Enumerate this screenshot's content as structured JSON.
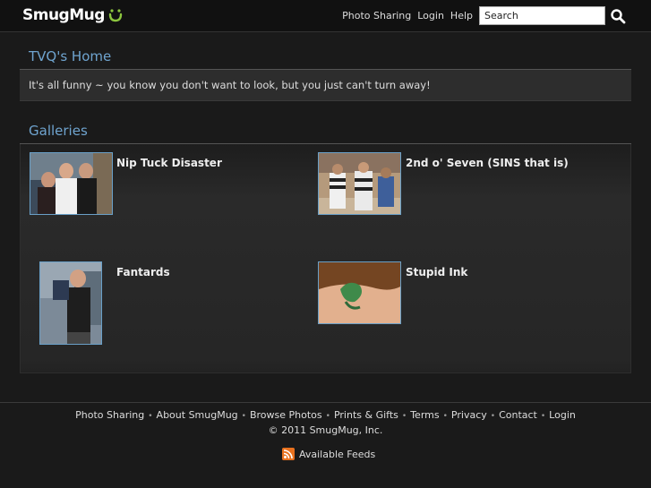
{
  "header": {
    "logo_text": "SmugMug",
    "nav": [
      "Photo Sharing",
      "Login",
      "Help"
    ],
    "search_placeholder": "Search"
  },
  "home": {
    "title": "TVQ's Home",
    "description": "It's all funny ~ you know you don't want to look, but you just can't turn away!"
  },
  "galleries": {
    "title": "Galleries",
    "items": [
      {
        "title": "Nip Tuck Disaster"
      },
      {
        "title": "2nd o' Seven (SINS that is)"
      },
      {
        "title": "Fantards"
      },
      {
        "title": "Stupid Ink"
      }
    ]
  },
  "footer": {
    "links": [
      "Photo Sharing",
      "About SmugMug",
      "Browse Photos",
      "Prints & Gifts",
      "Terms",
      "Privacy",
      "Contact",
      "Login"
    ],
    "copyright": "© 2011 SmugMug, Inc.",
    "feeds_label": "Available Feeds"
  },
  "colors": {
    "accent": "#6fa4cf",
    "logo_smile": "#8dc63f",
    "background": "#1a1a1a"
  }
}
